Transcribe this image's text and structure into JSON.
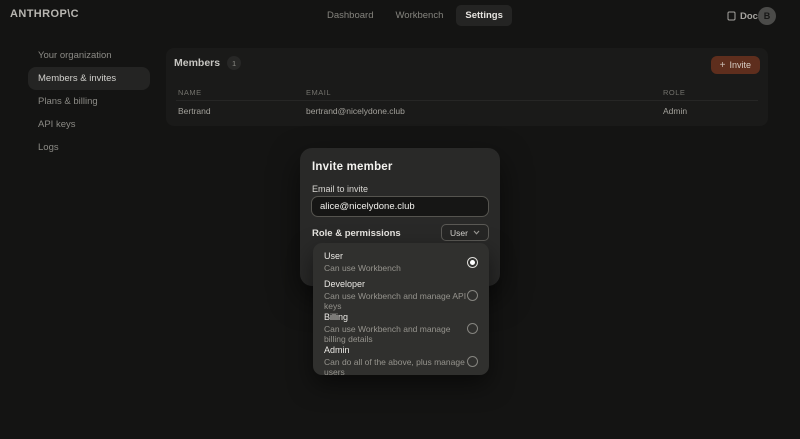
{
  "brand": {
    "logo": "ANTHROP\\C"
  },
  "nav": {
    "tabs": [
      {
        "label": "Dashboard",
        "active": false
      },
      {
        "label": "Workbench",
        "active": false
      },
      {
        "label": "Settings",
        "active": true
      }
    ],
    "docs_label": "Docs",
    "avatar_initial": "B"
  },
  "sidebar": {
    "items": [
      {
        "label": "Your organization",
        "active": false
      },
      {
        "label": "Members & invites",
        "active": true
      },
      {
        "label": "Plans & billing",
        "active": false
      },
      {
        "label": "API keys",
        "active": false
      },
      {
        "label": "Logs",
        "active": false
      }
    ]
  },
  "members_panel": {
    "title": "Members",
    "count_badge": "1",
    "invite_button": {
      "plus": "+",
      "label": "Invite"
    },
    "table": {
      "headers": {
        "name": "NAME",
        "email": "EMAIL",
        "role": "ROLE"
      },
      "rows": [
        {
          "name": "Bertrand",
          "email": "bertrand@nicelydone.club",
          "role": "Admin"
        }
      ]
    }
  },
  "modal": {
    "title": "Invite member",
    "email_label": "Email to invite",
    "email_value": "alice@nicelydone.club",
    "role_label": "Role & permissions",
    "role_dropdown_value": "User",
    "options": [
      {
        "title": "User",
        "description": "Can use Workbench",
        "selected": true
      },
      {
        "title": "Developer",
        "description": "Can use Workbench and manage API keys",
        "selected": false
      },
      {
        "title": "Billing",
        "description": "Can use Workbench and manage billing details",
        "selected": false
      },
      {
        "title": "Admin",
        "description": "Can do all of the above, plus manage users",
        "selected": false
      }
    ]
  },
  "colors": {
    "page_bg": "#141413",
    "panel_bg": "#1a1a19",
    "modal_bg": "#292928",
    "popover_bg": "#30302e",
    "invite_button_bg": "#5e2e1d",
    "active_pill_bg": "#242423"
  }
}
